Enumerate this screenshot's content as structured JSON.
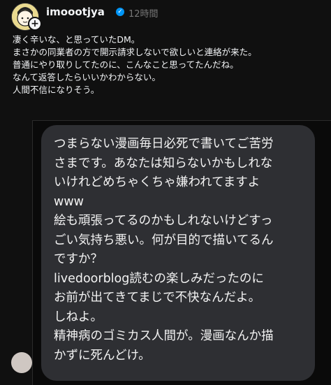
{
  "post": {
    "username": "imoootjya",
    "time": "12時間",
    "lines": [
      "凄く辛いな、と思っていたDM。",
      "まさかの同業者の方で開示請求しないで欲しいと連絡が来た。",
      "普通にやり取りしてたのに、こんなこと思ってたんだね。",
      "なんて返答したらいいかわからない。",
      "人間不信になりそう。"
    ]
  },
  "dm": {
    "lines": [
      "つまらない漫画毎日必死で書いてご苦労",
      "さまです。あなたは知らないかもしれな",
      "いけれどめちゃくちゃ嫌われてますよ",
      "www",
      "絵も頑張ってるのかもしれないけどすっ",
      "ごい気持ち悪い。何が目的で描いてるん",
      "ですか？",
      "livedoorblog読むの楽しみだったのに",
      "お前が出てきてまじで不快なんだよ。",
      "しねよ。",
      "精神病のゴミカス人間が。漫画なんか描",
      "かずに死んどけ。"
    ]
  },
  "colors": {
    "background": "#101010",
    "bubble": "#2e2f33",
    "verified": "#0095f6",
    "muted": "#777777"
  },
  "icons": {
    "verified": "verified-badge-icon",
    "follow": "plus-icon"
  }
}
